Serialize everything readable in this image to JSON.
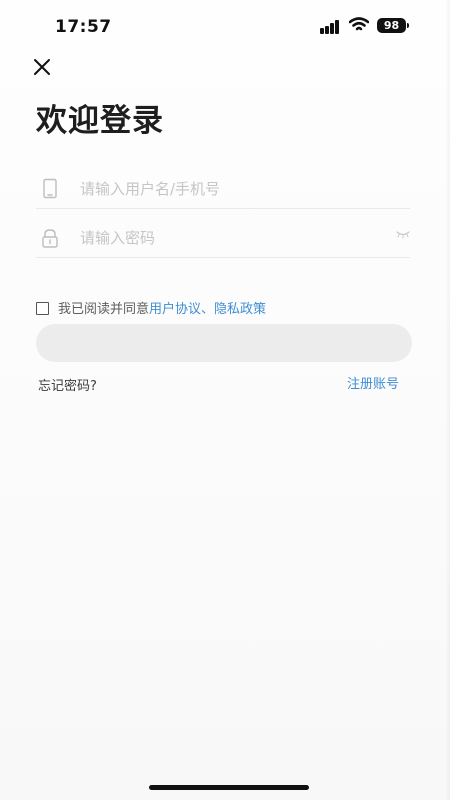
{
  "status_bar": {
    "time": "17:57",
    "battery": "98"
  },
  "icons": {
    "close": "close-icon",
    "phone": "phone-icon",
    "lock": "lock-icon",
    "eye": "eye-closed-icon"
  },
  "page": {
    "title": "欢迎登录"
  },
  "form": {
    "username_placeholder": "请输入用户名/手机号",
    "username_value": "",
    "password_placeholder": "请输入密码",
    "password_value": ""
  },
  "agreement": {
    "prefix": "我已阅读并同意",
    "user_agreement": "用户协议",
    "separator": "、",
    "privacy_policy": "隐私政策"
  },
  "actions": {
    "login_label": "",
    "forgot_password": "忘记密码?",
    "register": "注册账号"
  },
  "colors": {
    "accent": "#3f8ed6",
    "button_bg": "#ececec",
    "text": "#1e1e1e",
    "placeholder": "#c5c5c5"
  }
}
